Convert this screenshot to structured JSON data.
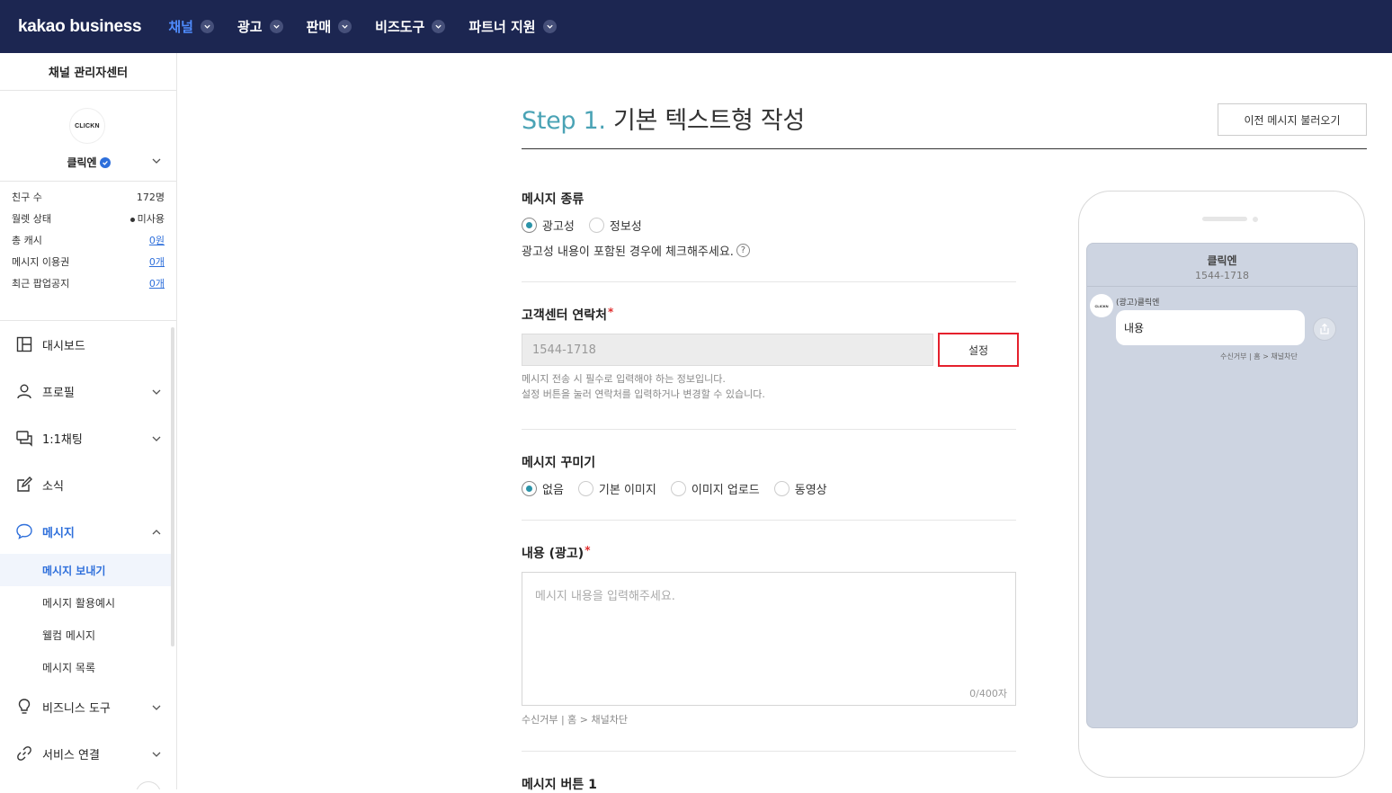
{
  "topbar": {
    "logo": "kakao business",
    "nav": [
      {
        "label": "채널",
        "active": true
      },
      {
        "label": "광고"
      },
      {
        "label": "판매"
      },
      {
        "label": "비즈도구"
      },
      {
        "label": "파트너 지원"
      }
    ]
  },
  "sidebar": {
    "title": "채널 관리자센터",
    "profile": {
      "avatar_text": "CLICKN",
      "name": "클릭엔"
    },
    "stats": [
      {
        "label": "친구 수",
        "value": "172명"
      },
      {
        "label": "월렛 상태",
        "value": "미사용"
      },
      {
        "label": "총 캐시",
        "value": "0원"
      },
      {
        "label": "메시지 이용권",
        "value": "0개"
      },
      {
        "label": "최근 팝업공지",
        "value": "0개"
      }
    ],
    "menu": {
      "dashboard": "대시보드",
      "profile": "프로필",
      "chat": "1:1채팅",
      "news": "소식",
      "message": "메시지",
      "sub": [
        "메시지 보내기",
        "메시지 활용예시",
        "웰컴 메시지",
        "메시지 목록"
      ],
      "biztools": "비즈니스 도구",
      "service": "서비스 연결"
    }
  },
  "main": {
    "step": "Step 1.",
    "title": "기본 텍스트형 작성",
    "load_button": "이전 메시지 불러오기",
    "message_type": {
      "label": "메시지 종류",
      "options": [
        "광고성",
        "정보성"
      ],
      "selected": "광고성",
      "hint": "광고성 내용이 포함된 경우에 체크해주세요.",
      "help_icon": "?"
    },
    "contact": {
      "label": "고객센터 연락처",
      "required_mark": "*",
      "value": "1544-1718",
      "set_button": "설정",
      "note1": "메시지 전송 시 필수로 입력해야 하는 정보입니다.",
      "note2": "설정 버튼을 눌러 연락처를 입력하거나 변경할 수 있습니다."
    },
    "decorate": {
      "label": "메시지 꾸미기",
      "options": [
        "없음",
        "기본 이미지",
        "이미지 업로드",
        "동영상"
      ],
      "selected": "없음"
    },
    "content": {
      "label": "내용 (광고)",
      "required_mark": "*",
      "placeholder": "메시지 내용을 입력해주세요.",
      "counter": "0/400자",
      "footer": "수신거부 | 홈 > 채널차단"
    },
    "button_section": {
      "label": "메시지 버튼 1"
    }
  },
  "preview": {
    "channel_name": "클릭엔",
    "phone": "1544-1718",
    "avatar_text": "CLICKN",
    "sender": "(광고)클릭엔",
    "bubble": "내용",
    "footer": "수신거부 | 홈 > 채널차단"
  },
  "colors": {
    "topbar": "#1c2651",
    "accent": "#2e6fdb",
    "step": "#4aa3b5",
    "highlight": "#e5202c"
  }
}
